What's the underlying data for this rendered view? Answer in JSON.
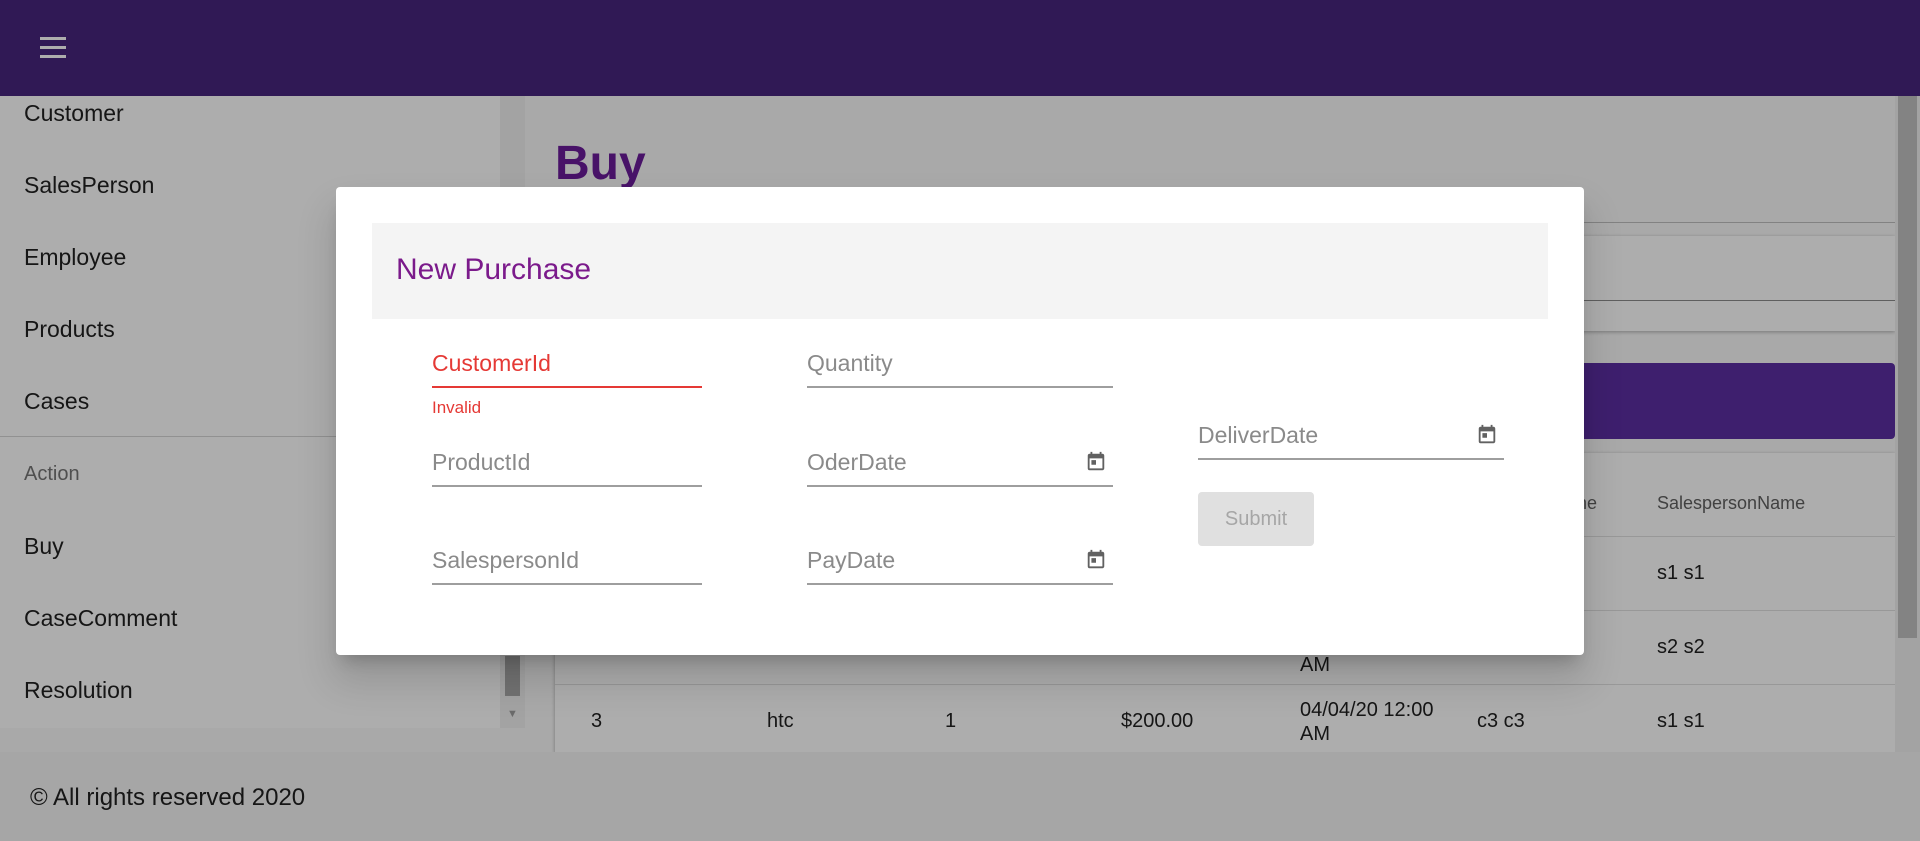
{
  "sidebar": {
    "items": [
      {
        "label": "Customer"
      },
      {
        "label": "SalesPerson"
      },
      {
        "label": "Employee"
      },
      {
        "label": "Products"
      },
      {
        "label": "Cases"
      }
    ],
    "section_label": "Action",
    "action_items": [
      {
        "label": "Buy"
      },
      {
        "label": "CaseComment"
      },
      {
        "label": "Resolution"
      }
    ]
  },
  "main": {
    "title": "Buy",
    "table": {
      "headers": [
        "ne",
        "SalespersonName"
      ],
      "rows": [
        {
          "salesperson": "s1 s1"
        },
        {
          "date_tail": "AM",
          "salesperson": "s2 s2"
        },
        {
          "id": "3",
          "product": "htc",
          "qty": "1",
          "price": "$200.00",
          "date": "04/04/20 12:00 AM",
          "customer": "c3 c3",
          "salesperson": "s1 s1"
        }
      ]
    }
  },
  "dialog": {
    "title": "New Purchase",
    "fields": {
      "customer_id": {
        "label": "CustomerId",
        "error": "Invalid"
      },
      "product_id": {
        "label": "ProductId"
      },
      "salesperson_id": {
        "label": "SalespersonId"
      },
      "quantity": {
        "label": "Quantity"
      },
      "oder_date": {
        "label": "OderDate",
        "icon": "calendar-icon"
      },
      "pay_date": {
        "label": "PayDate",
        "icon": "calendar-icon"
      },
      "deliver_date": {
        "label": "DeliverDate",
        "icon": "calendar-icon"
      }
    },
    "submit_label": "Submit"
  },
  "footer": {
    "text": "© All rights reserved 2020"
  },
  "colors": {
    "brand": "#48267e",
    "title": "#6a1b9a",
    "dialog_title": "#7b1a8b",
    "error": "#e53935"
  },
  "icons": {
    "menu": "menu-icon",
    "calendar": "calendar-icon"
  }
}
